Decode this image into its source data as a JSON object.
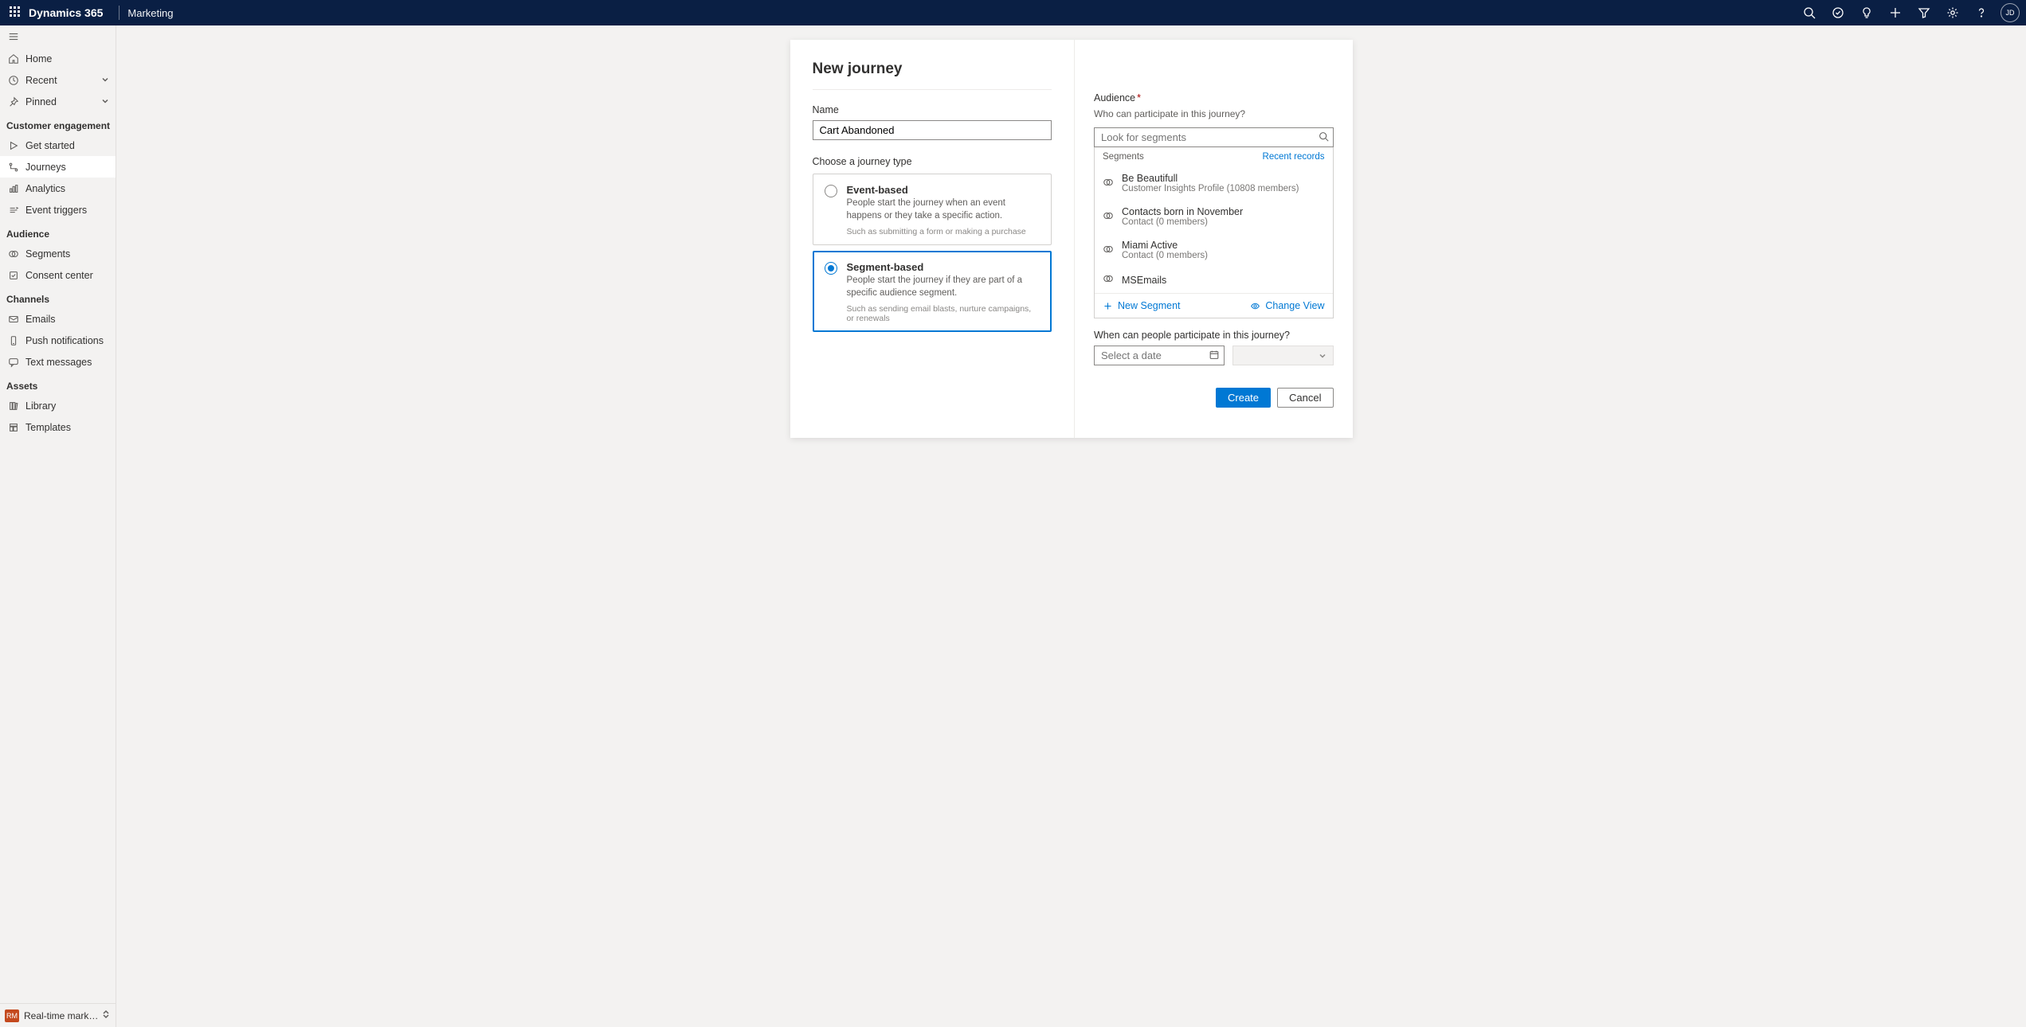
{
  "topbar": {
    "product": "Dynamics 365",
    "module": "Marketing",
    "avatar_initials": "JD"
  },
  "sidebar": {
    "home": "Home",
    "recent": "Recent",
    "pinned": "Pinned",
    "sections": {
      "engagement": {
        "title": "Customer engagement",
        "items": {
          "get_started": "Get started",
          "journeys": "Journeys",
          "analytics": "Analytics",
          "event_triggers": "Event triggers"
        }
      },
      "audience": {
        "title": "Audience",
        "items": {
          "segments": "Segments",
          "consent_center": "Consent center"
        }
      },
      "channels": {
        "title": "Channels",
        "items": {
          "emails": "Emails",
          "push": "Push notifications",
          "texts": "Text messages"
        }
      },
      "assets": {
        "title": "Assets",
        "items": {
          "library": "Library",
          "templates": "Templates"
        }
      }
    },
    "footer": {
      "badge": "RM",
      "label": "Real-time marketi..."
    }
  },
  "modal": {
    "title": "New journey",
    "name_label": "Name",
    "name_value": "Cart Abandoned",
    "type_label": "Choose a journey type",
    "options": {
      "event": {
        "title": "Event-based",
        "desc": "People start the journey when an event happens or they take a specific action.",
        "example": "Such as submitting a form or making a purchase"
      },
      "segment": {
        "title": "Segment-based",
        "desc": "People start the journey if they are part of a specific audience segment.",
        "example": "Such as sending email blasts, nurture campaigns, or renewals"
      }
    },
    "audience_label": "Audience",
    "audience_help": "Who can participate in this journey?",
    "search_placeholder": "Look for segments",
    "dd_header_left": "Segments",
    "dd_header_right": "Recent records",
    "segments": [
      {
        "name": "Be Beautifull",
        "sub": "Customer Insights Profile (10808 members)"
      },
      {
        "name": "Contacts born in November",
        "sub": "Contact (0 members)"
      },
      {
        "name": "Miami Active",
        "sub": "Contact (0 members)"
      },
      {
        "name": "MSEmails",
        "sub": ""
      }
    ],
    "new_segment": "New Segment",
    "change_view": "Change View",
    "when_label": "When can people participate in this journey?",
    "date_placeholder": "Select a date",
    "create": "Create",
    "cancel": "Cancel"
  }
}
